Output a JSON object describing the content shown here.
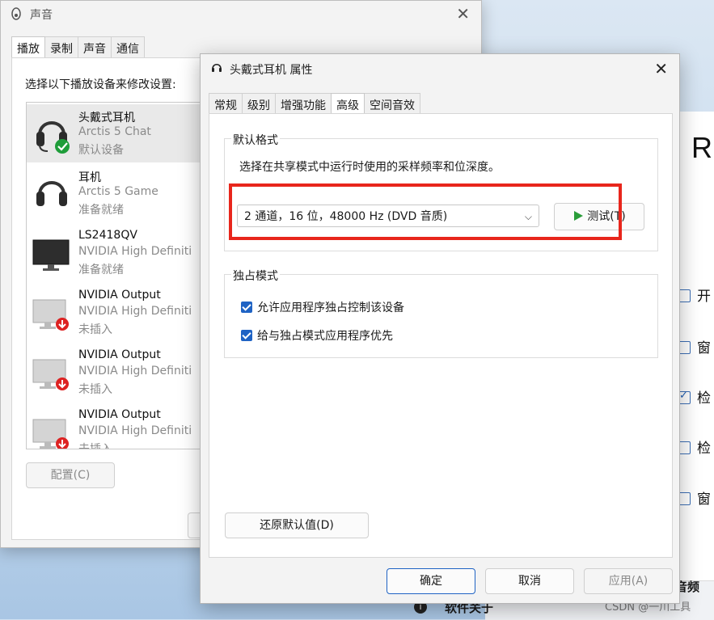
{
  "background_app": {
    "header_letter": "R",
    "checkbox_rows": [
      {
        "label": "开",
        "checked": false
      },
      {
        "label": "窗",
        "checked": false
      },
      {
        "label": "检",
        "checked": true
      },
      {
        "label": "检",
        "checked": false
      },
      {
        "label": "窗",
        "checked": false
      }
    ],
    "footer_line1": "音频",
    "footer_line2": "软件关于",
    "watermark": "CSDN @一川工具"
  },
  "sound_window": {
    "title": "声音",
    "tabs": [
      "播放",
      "录制",
      "声音",
      "通信"
    ],
    "active_tab": 0,
    "prompt": "选择以下播放设备来修改设置:",
    "devices": [
      {
        "name": "头戴式耳机",
        "desc": "Arctis 5 Chat",
        "status": "默认设备",
        "icon": "headset-icon",
        "badge": "default-check"
      },
      {
        "name": "耳机",
        "desc": "Arctis 5 Game",
        "status": "准备就绪",
        "icon": "headphones-icon",
        "badge": ""
      },
      {
        "name": "LS2418QV",
        "desc": "NVIDIA High Definiti",
        "status": "准备就绪",
        "icon": "monitor-icon",
        "badge": ""
      },
      {
        "name": "NVIDIA Output",
        "desc": "NVIDIA High Definiti",
        "status": "未插入",
        "icon": "monitor-icon",
        "badge": "unplugged"
      },
      {
        "name": "NVIDIA Output",
        "desc": "NVIDIA High Definiti",
        "status": "未插入",
        "icon": "monitor-icon",
        "badge": "unplugged"
      },
      {
        "name": "NVIDIA Output",
        "desc": "NVIDIA High Definiti",
        "status": "未插入",
        "icon": "monitor-icon",
        "badge": "unplugged"
      }
    ],
    "configure_button": "配置(C)"
  },
  "properties_dialog": {
    "title": "头戴式耳机 属性",
    "tabs": [
      "常规",
      "级别",
      "增强功能",
      "高级",
      "空间音效"
    ],
    "active_tab": 3,
    "default_format": {
      "group_title": "默认格式",
      "description": "选择在共享模式中运行时使用的采样频率和位深度。",
      "selected_format": "2 通道，16 位，48000 Hz (DVD 音质)",
      "test_button": "测试(T)"
    },
    "exclusive_mode": {
      "group_title": "独占模式",
      "options": [
        {
          "label": "允许应用程序独占控制该设备",
          "checked": true
        },
        {
          "label": "给与独占模式应用程序优先",
          "checked": true
        }
      ]
    },
    "restore_defaults_button": "还原默认值(D)",
    "ok_button": "确定",
    "cancel_button": "取消",
    "apply_button": "应用(A)"
  },
  "colors": {
    "accent": "#1f63c4",
    "highlight_box": "#e8261c",
    "play_icon": "#2a9d3a"
  }
}
